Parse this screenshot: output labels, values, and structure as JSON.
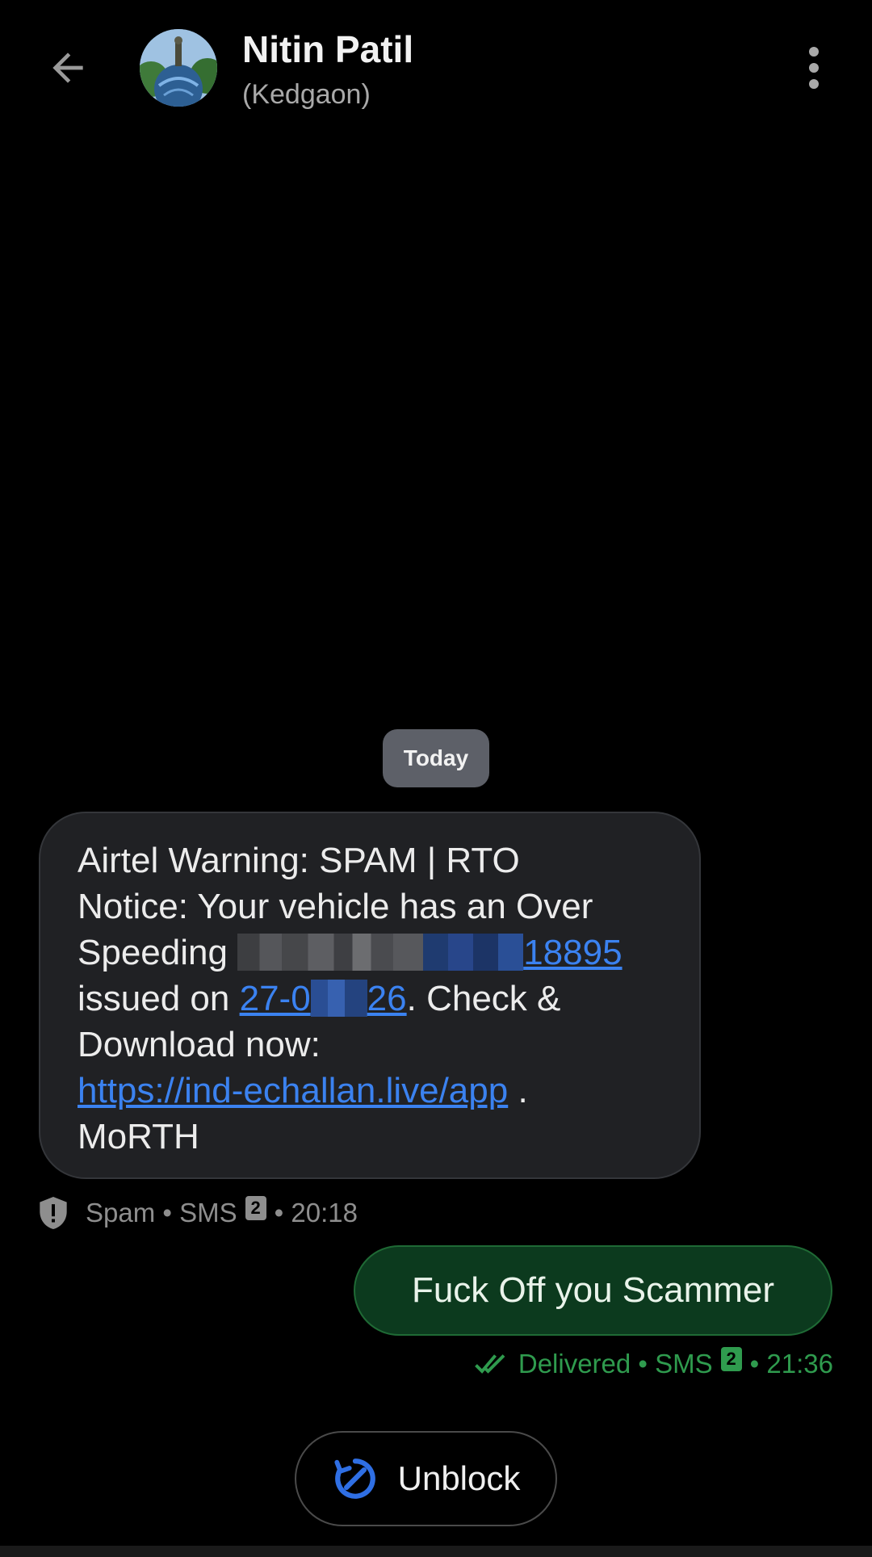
{
  "header": {
    "back_icon": "arrow-back-icon",
    "contact_name": "Nitin Patil",
    "contact_subtitle": "(Kedgaon)",
    "more_icon": "more-vertical-icon"
  },
  "conversation": {
    "date_chip": "Today",
    "incoming": {
      "lines": {
        "l1": "Airtel Warning: SPAM | RTO",
        "l2": "Notice: Your vehicle has an Over",
        "l3_prefix": "Speeding",
        "l3_link_tail": "18895",
        "l4_prefix": "issued on",
        "l4_link_start": "27-0",
        "l4_link_end": "26",
        "l4_suffix": ". Check &",
        "l5": "Download now:",
        "l6_link": "https://ind-echallan.live/app",
        "l6_suffix": " .",
        "l7": "MoRTH"
      },
      "meta": {
        "shield_icon": "shield-icon",
        "label": "Spam",
        "channel": "SMS",
        "sim": "2",
        "time": "20:18"
      }
    },
    "outgoing": {
      "text": "Fuck Off you Scammer",
      "meta": {
        "status_icon": "double-check-icon",
        "status": "Delivered",
        "channel": "SMS",
        "sim": "2",
        "time": "21:36"
      }
    }
  },
  "actions": {
    "unblock_icon": "unblock-icon",
    "unblock_label": "Unblock"
  },
  "colors": {
    "background": "#000000",
    "incoming_bubble": "#202124",
    "outgoing_bubble": "#0c3a1e",
    "link": "#3b82f0",
    "delivered_green": "#2f9b4e",
    "unblock_icon": "#2f6fe4"
  }
}
